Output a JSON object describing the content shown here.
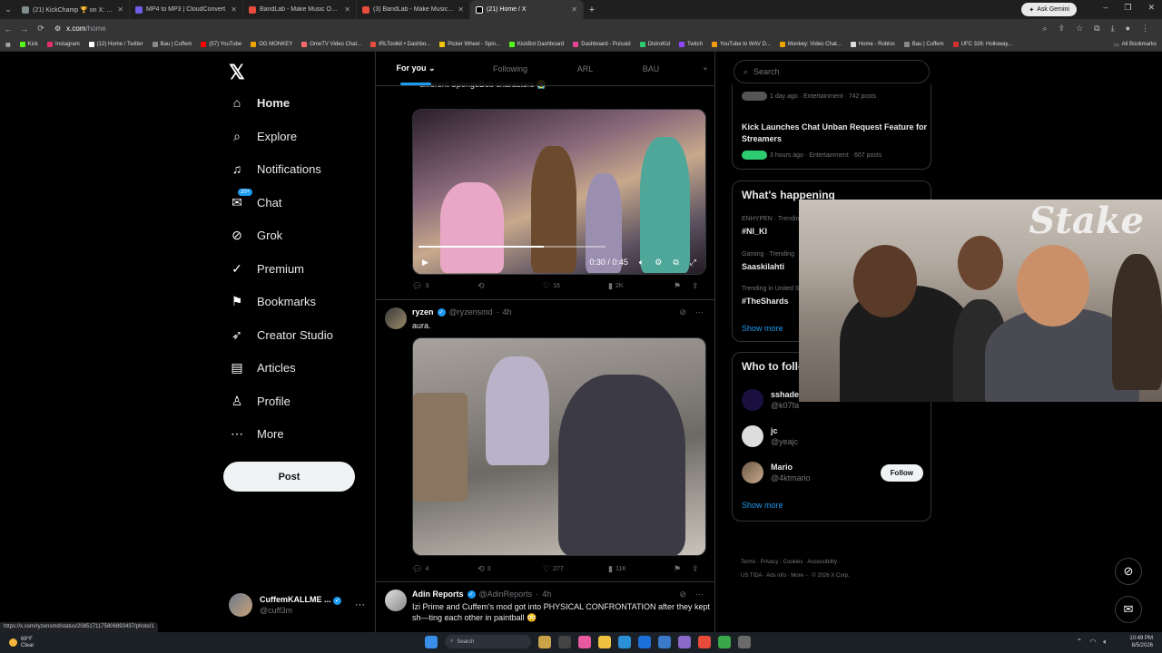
{
  "browser": {
    "tabs": [
      {
        "title": "(21) KickChamp 🏆 on X: \"Cuff",
        "color": "#7f8c8d"
      },
      {
        "title": "MP4 to MP3 | CloudConvert",
        "color": "#6c5ce7"
      },
      {
        "title": "BandLab - Make Music Online",
        "color": "#e74c3c"
      },
      {
        "title": "(3) BandLab - Make Music Onli",
        "color": "#e74c3c"
      },
      {
        "title": "(21) Home / X",
        "color": "#ffffff"
      }
    ],
    "ask_label": "Ask Gemini",
    "url_domain": "x.com",
    "url_path": "/home",
    "bookmarks": [
      {
        "label": "Kick",
        "color": "#53fc18"
      },
      {
        "label": "Instagram",
        "color": "#e1306c"
      },
      {
        "label": "(12) Home / Twitter",
        "color": "#ffffff"
      },
      {
        "label": "Bau | Cuffem",
        "color": "#888888"
      },
      {
        "label": "(57) YouTube",
        "color": "#ff0000"
      },
      {
        "label": "OG MONKEY",
        "color": "#f0a500"
      },
      {
        "label": "OmeTV Video Chat...",
        "color": "#ff6b6b"
      },
      {
        "label": "IRLToolkit • Dashbo...",
        "color": "#e74c3c"
      },
      {
        "label": "Picker Wheel - Spin...",
        "color": "#f1c40f"
      },
      {
        "label": "KickBot Dashboard",
        "color": "#53fc18"
      },
      {
        "label": "Dashboard - Pulsoid",
        "color": "#e84393"
      },
      {
        "label": "DistroKid",
        "color": "#2ecc71"
      },
      {
        "label": "Twitch",
        "color": "#9146ff"
      },
      {
        "label": "YouTube to WAV D...",
        "color": "#f39c12"
      },
      {
        "label": "Monkey: Video Chat...",
        "color": "#f0a500"
      },
      {
        "label": "Home - Roblox",
        "color": "#dddddd"
      },
      {
        "label": "Bau | Cuffem",
        "color": "#888888"
      },
      {
        "label": "UFC 326: Holloway...",
        "color": "#d63031"
      }
    ],
    "all_bookmarks": "All Bookmarks",
    "status_url": "https://x.com/ryzensmd/status/2085171175806893437/photo/1"
  },
  "nav": {
    "items": [
      {
        "label": "Home",
        "icon": "home-icon",
        "glyph": "⌂"
      },
      {
        "label": "Explore",
        "icon": "search-icon",
        "glyph": "⌕"
      },
      {
        "label": "Notifications",
        "icon": "bell-icon",
        "glyph": "🔔︎"
      },
      {
        "label": "Chat",
        "icon": "chat-icon",
        "glyph": "✉"
      },
      {
        "label": "Grok",
        "icon": "grok-icon",
        "glyph": "⊘"
      },
      {
        "label": "Premium",
        "icon": "premium-icon",
        "glyph": "✓"
      },
      {
        "label": "Bookmarks",
        "icon": "bookmark-icon",
        "glyph": "🔖︎"
      },
      {
        "label": "Creator Studio",
        "icon": "rocket-icon",
        "glyph": "➶"
      },
      {
        "label": "Articles",
        "icon": "article-icon",
        "glyph": "▤"
      },
      {
        "label": "Profile",
        "icon": "person-icon",
        "glyph": "👤︎"
      },
      {
        "label": "More",
        "icon": "more-circle-icon",
        "glyph": "⋯"
      }
    ],
    "chat_badge": "20+",
    "post_label": "Post",
    "account": {
      "name": "CuffemKALLME ...",
      "handle": "@cuff3m"
    }
  },
  "feed": {
    "tabs": [
      "For you",
      "Following",
      "ARL",
      "BAU"
    ],
    "tweet1": {
      "caption": "different SpongeBob characters 😭",
      "time": "0:30 / 0:45",
      "progress_pct": 67,
      "replies": "3",
      "likes": "16",
      "views": "2K"
    },
    "tweet2": {
      "name": "ryzen",
      "handle": "@ryzensmd",
      "ago": "4h",
      "text": "aura.",
      "replies": "4",
      "reposts": "3",
      "likes": "277",
      "views": "11K"
    },
    "tweet3": {
      "name": "Adin Reports",
      "handle": "@AdinReports",
      "ago": "4h",
      "text": "Izi Prime and Cuffem's mod got into PHYSICAL CONFRONTATION after they kept sh—ting each other in paintball 😳"
    }
  },
  "right": {
    "search_placeholder": "Search",
    "news": [
      {
        "meta": "1 day ago · Entertainment · 742 posts"
      },
      {
        "headline": "Kick Launches Chat Unban Request Feature for Streamers",
        "meta": "3 hours ago · Entertainment · 607 posts"
      }
    ],
    "happening": {
      "title": "What's happening",
      "trends": [
        {
          "context": "ENHYPEN · Trending",
          "name": "#NI_KI"
        },
        {
          "context": "Gaming · Trending",
          "name": "Saaskilahti"
        },
        {
          "context": "Trending in United States",
          "name": "#TheShards"
        }
      ],
      "show_more": "Show more"
    },
    "who_to_follow": {
      "title": "Who to follow",
      "users": [
        {
          "name": "sshade",
          "handle": "@k07fa"
        },
        {
          "name": "jc",
          "handle": "@yeajc"
        },
        {
          "name": "Mario",
          "handle": "@4ktmario",
          "follow": "Follow"
        }
      ],
      "show_more": "Show more"
    },
    "footer": {
      "line1": "Terms · Privacy · Cookies · Accessibility ·",
      "line2": "US TIDA · Ads info · More ··· © 2026 X Corp."
    }
  },
  "webcam": {
    "sign": "Stake"
  },
  "taskbar": {
    "temp": "69°F",
    "weather": "Clear",
    "search_label": "Search",
    "time": "10:49 PM",
    "date": "8/5/2026"
  }
}
